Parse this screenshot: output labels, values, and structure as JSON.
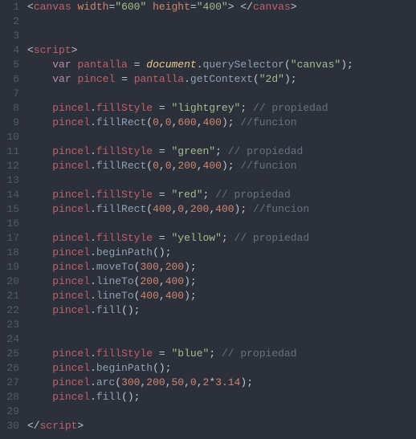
{
  "lines": [
    {
      "n": "1",
      "segs": [
        [
          "punc",
          "<"
        ],
        [
          "tag",
          "canvas"
        ],
        [
          "punc",
          " "
        ],
        [
          "attr",
          "width"
        ],
        [
          "punc",
          "="
        ],
        [
          "str",
          "\"600\""
        ],
        [
          "punc",
          " "
        ],
        [
          "attr",
          "height"
        ],
        [
          "punc",
          "="
        ],
        [
          "str",
          "\"400\""
        ],
        [
          "punc",
          "> </"
        ],
        [
          "tag",
          "canvas"
        ],
        [
          "punc",
          ">"
        ]
      ]
    },
    {
      "n": "2",
      "segs": []
    },
    {
      "n": "3",
      "segs": []
    },
    {
      "n": "4",
      "segs": [
        [
          "punc",
          "<"
        ],
        [
          "tag",
          "script"
        ],
        [
          "punc",
          ">"
        ]
      ]
    },
    {
      "n": "5",
      "segs": [
        [
          "punc",
          "    "
        ],
        [
          "kw",
          "var"
        ],
        [
          "punc",
          " "
        ],
        [
          "var",
          "pantalla"
        ],
        [
          "punc",
          " "
        ],
        [
          "op",
          "="
        ],
        [
          "punc",
          " "
        ],
        [
          "obj",
          "document"
        ],
        [
          "punc",
          "."
        ],
        [
          "method",
          "querySelector"
        ],
        [
          "punc",
          "("
        ],
        [
          "str",
          "\"canvas\""
        ],
        [
          "punc",
          ");"
        ]
      ]
    },
    {
      "n": "6",
      "segs": [
        [
          "punc",
          "    "
        ],
        [
          "kw",
          "var"
        ],
        [
          "punc",
          " "
        ],
        [
          "var",
          "pincel"
        ],
        [
          "punc",
          " "
        ],
        [
          "op",
          "="
        ],
        [
          "punc",
          " "
        ],
        [
          "var",
          "pantalla"
        ],
        [
          "punc",
          "."
        ],
        [
          "method",
          "getContext"
        ],
        [
          "punc",
          "("
        ],
        [
          "str",
          "\"2d\""
        ],
        [
          "punc",
          ");"
        ]
      ]
    },
    {
      "n": "7",
      "segs": []
    },
    {
      "n": "8",
      "segs": [
        [
          "punc",
          "    "
        ],
        [
          "var",
          "pincel"
        ],
        [
          "punc",
          "."
        ],
        [
          "var",
          "fillStyle"
        ],
        [
          "punc",
          " "
        ],
        [
          "op",
          "="
        ],
        [
          "punc",
          " "
        ],
        [
          "str",
          "\"lightgrey\""
        ],
        [
          "punc",
          "; "
        ],
        [
          "comment",
          "// propiedad"
        ]
      ]
    },
    {
      "n": "9",
      "segs": [
        [
          "punc",
          "    "
        ],
        [
          "var",
          "pincel"
        ],
        [
          "punc",
          "."
        ],
        [
          "method",
          "fillRect"
        ],
        [
          "punc",
          "("
        ],
        [
          "num",
          "0"
        ],
        [
          "punc",
          ","
        ],
        [
          "num",
          "0"
        ],
        [
          "punc",
          ","
        ],
        [
          "num",
          "600"
        ],
        [
          "punc",
          ","
        ],
        [
          "num",
          "400"
        ],
        [
          "punc",
          "); "
        ],
        [
          "comment",
          "//funcion"
        ]
      ]
    },
    {
      "n": "10",
      "segs": []
    },
    {
      "n": "11",
      "segs": [
        [
          "punc",
          "    "
        ],
        [
          "var",
          "pincel"
        ],
        [
          "punc",
          "."
        ],
        [
          "var",
          "fillStyle"
        ],
        [
          "punc",
          " "
        ],
        [
          "op",
          "="
        ],
        [
          "punc",
          " "
        ],
        [
          "str",
          "\"green\""
        ],
        [
          "punc",
          "; "
        ],
        [
          "comment",
          "// propiedad"
        ]
      ]
    },
    {
      "n": "12",
      "segs": [
        [
          "punc",
          "    "
        ],
        [
          "var",
          "pincel"
        ],
        [
          "punc",
          "."
        ],
        [
          "method",
          "fillRect"
        ],
        [
          "punc",
          "("
        ],
        [
          "num",
          "0"
        ],
        [
          "punc",
          ","
        ],
        [
          "num",
          "0"
        ],
        [
          "punc",
          ","
        ],
        [
          "num",
          "200"
        ],
        [
          "punc",
          ","
        ],
        [
          "num",
          "400"
        ],
        [
          "punc",
          "); "
        ],
        [
          "comment",
          "//funcion"
        ]
      ]
    },
    {
      "n": "13",
      "segs": []
    },
    {
      "n": "14",
      "segs": [
        [
          "punc",
          "    "
        ],
        [
          "var",
          "pincel"
        ],
        [
          "punc",
          "."
        ],
        [
          "var",
          "fillStyle"
        ],
        [
          "punc",
          " "
        ],
        [
          "op",
          "="
        ],
        [
          "punc",
          " "
        ],
        [
          "str",
          "\"red\""
        ],
        [
          "punc",
          "; "
        ],
        [
          "comment",
          "// propiedad"
        ]
      ]
    },
    {
      "n": "15",
      "segs": [
        [
          "punc",
          "    "
        ],
        [
          "var",
          "pincel"
        ],
        [
          "punc",
          "."
        ],
        [
          "method",
          "fillRect"
        ],
        [
          "punc",
          "("
        ],
        [
          "num",
          "400"
        ],
        [
          "punc",
          ","
        ],
        [
          "num",
          "0"
        ],
        [
          "punc",
          ","
        ],
        [
          "num",
          "200"
        ],
        [
          "punc",
          ","
        ],
        [
          "num",
          "400"
        ],
        [
          "punc",
          "); "
        ],
        [
          "comment",
          "//funcion"
        ]
      ]
    },
    {
      "n": "16",
      "segs": []
    },
    {
      "n": "17",
      "segs": [
        [
          "punc",
          "    "
        ],
        [
          "var",
          "pincel"
        ],
        [
          "punc",
          "."
        ],
        [
          "var",
          "fillStyle"
        ],
        [
          "punc",
          " "
        ],
        [
          "op",
          "="
        ],
        [
          "punc",
          " "
        ],
        [
          "str",
          "\"yellow\""
        ],
        [
          "punc",
          "; "
        ],
        [
          "comment",
          "// propiedad"
        ]
      ]
    },
    {
      "n": "18",
      "segs": [
        [
          "punc",
          "    "
        ],
        [
          "var",
          "pincel"
        ],
        [
          "punc",
          "."
        ],
        [
          "method",
          "beginPath"
        ],
        [
          "punc",
          "();"
        ]
      ]
    },
    {
      "n": "19",
      "segs": [
        [
          "punc",
          "    "
        ],
        [
          "var",
          "pincel"
        ],
        [
          "punc",
          "."
        ],
        [
          "method",
          "moveTo"
        ],
        [
          "punc",
          "("
        ],
        [
          "num",
          "300"
        ],
        [
          "punc",
          ","
        ],
        [
          "num",
          "200"
        ],
        [
          "punc",
          ");"
        ]
      ]
    },
    {
      "n": "20",
      "segs": [
        [
          "punc",
          "    "
        ],
        [
          "var",
          "pincel"
        ],
        [
          "punc",
          "."
        ],
        [
          "method",
          "lineTo"
        ],
        [
          "punc",
          "("
        ],
        [
          "num",
          "200"
        ],
        [
          "punc",
          ","
        ],
        [
          "num",
          "400"
        ],
        [
          "punc",
          ");"
        ]
      ]
    },
    {
      "n": "21",
      "segs": [
        [
          "punc",
          "    "
        ],
        [
          "var",
          "pincel"
        ],
        [
          "punc",
          "."
        ],
        [
          "method",
          "lineTo"
        ],
        [
          "punc",
          "("
        ],
        [
          "num",
          "400"
        ],
        [
          "punc",
          ","
        ],
        [
          "num",
          "400"
        ],
        [
          "punc",
          ");"
        ]
      ]
    },
    {
      "n": "22",
      "segs": [
        [
          "punc",
          "    "
        ],
        [
          "var",
          "pincel"
        ],
        [
          "punc",
          "."
        ],
        [
          "method",
          "fill"
        ],
        [
          "punc",
          "();"
        ]
      ]
    },
    {
      "n": "23",
      "segs": []
    },
    {
      "n": "24",
      "segs": []
    },
    {
      "n": "25",
      "segs": [
        [
          "punc",
          "    "
        ],
        [
          "var",
          "pincel"
        ],
        [
          "punc",
          "."
        ],
        [
          "var",
          "fillStyle"
        ],
        [
          "punc",
          " "
        ],
        [
          "op",
          "="
        ],
        [
          "punc",
          " "
        ],
        [
          "str",
          "\"blue\""
        ],
        [
          "punc",
          "; "
        ],
        [
          "comment",
          "// propiedad"
        ]
      ]
    },
    {
      "n": "26",
      "segs": [
        [
          "punc",
          "    "
        ],
        [
          "var",
          "pincel"
        ],
        [
          "punc",
          "."
        ],
        [
          "method",
          "beginPath"
        ],
        [
          "punc",
          "();"
        ]
      ]
    },
    {
      "n": "27",
      "segs": [
        [
          "punc",
          "    "
        ],
        [
          "var",
          "pincel"
        ],
        [
          "punc",
          "."
        ],
        [
          "method",
          "arc"
        ],
        [
          "punc",
          "("
        ],
        [
          "num",
          "300"
        ],
        [
          "punc",
          ","
        ],
        [
          "num",
          "200"
        ],
        [
          "punc",
          ","
        ],
        [
          "num",
          "50"
        ],
        [
          "punc",
          ","
        ],
        [
          "num",
          "0"
        ],
        [
          "punc",
          ","
        ],
        [
          "num",
          "2"
        ],
        [
          "op",
          "*"
        ],
        [
          "num",
          "3.14"
        ],
        [
          "punc",
          ");"
        ]
      ]
    },
    {
      "n": "28",
      "segs": [
        [
          "punc",
          "    "
        ],
        [
          "var",
          "pincel"
        ],
        [
          "punc",
          "."
        ],
        [
          "method",
          "fill"
        ],
        [
          "punc",
          "();"
        ]
      ]
    },
    {
      "n": "29",
      "segs": []
    },
    {
      "n": "30",
      "segs": [
        [
          "punc",
          "</"
        ],
        [
          "tag",
          "script"
        ],
        [
          "punc",
          ">"
        ]
      ]
    }
  ]
}
